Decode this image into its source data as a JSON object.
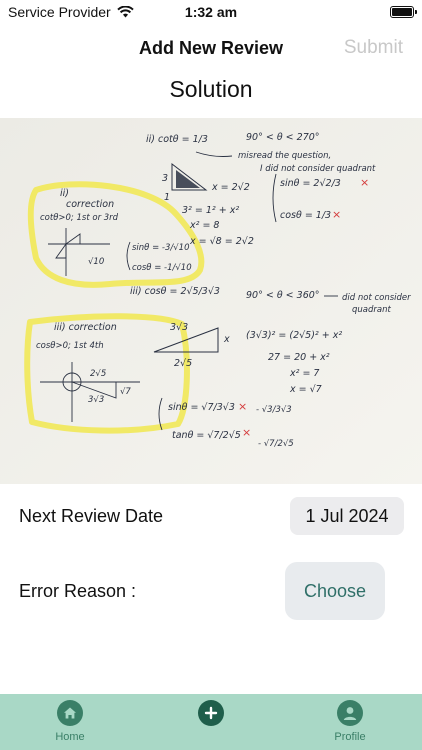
{
  "status_bar": {
    "carrier": "Service Provider",
    "time": "1:32 am"
  },
  "nav": {
    "title": "Add New Review",
    "submit_label": "Submit"
  },
  "section_title": "Solution",
  "photo": {
    "description": "handwritten math solution photo"
  },
  "form": {
    "next_review_label": "Next Review Date",
    "next_review_value": "1 Jul 2024",
    "error_reason_label": "Error Reason :",
    "choose_label": "Choose"
  },
  "tabs": [
    {
      "label": "Home",
      "icon": "home-icon"
    },
    {
      "label": "",
      "icon": "add-icon"
    },
    {
      "label": "Profile",
      "icon": "profile-icon"
    }
  ],
  "colors": {
    "accent": "#3a7f67",
    "tab_bar": "#a9d8c6",
    "highlight": "#f1e85a"
  },
  "handwriting": {
    "p2_head": "ii) cotθ = 1/3",
    "p2_range": "90° < θ < 270°",
    "p2_note1": "misread the question,",
    "p2_note2": "I did not consider quadrant",
    "p2_x": "x = 2√2",
    "p2_eq1": "3² = 1² + x²",
    "p2_eq2": "x² = 8",
    "p2_eq3": "x = √8 = 2√2",
    "p2_sin": "sinθ = 2√2/3",
    "p2_cos": "cosθ = 1/3",
    "c1_num": "ii)",
    "c1_head": "correction",
    "c1_cond": "cotθ>0; 1st or 3rd",
    "c1_r": "√10",
    "c1_sin": "sinθ = -3/√10",
    "c1_cos": "cosθ = -1/√10",
    "p3_head": "iii) cosθ = 2√5/3√3",
    "p3_range": "90° < θ < 360°",
    "p3_note1": "did not consider",
    "p3_note2": "quadrant",
    "p3_eq1": "(3√3)² = (2√5)² + x²",
    "p3_eq2": "27 = 20 + x²",
    "p3_eq3": "x² = 7",
    "p3_eq4": "x = √7",
    "p3_sin": "sinθ = √7/3√3",
    "p3_sin2": "- √3/3√3",
    "p3_tan": "tanθ = √7/2√5",
    "p3_tan2": "- √7/2√5",
    "c2_head": "iii) correction",
    "c2_cond": "cosθ>0; 1st 4th",
    "c2_a": "2√5",
    "c2_b": "3√3",
    "c2_c": "√7",
    "tri_a": "3√3",
    "tri_b": "2√5",
    "tri_x": "x",
    "tri1_a": "3",
    "tri1_b": "1",
    "mark_x": "×"
  }
}
